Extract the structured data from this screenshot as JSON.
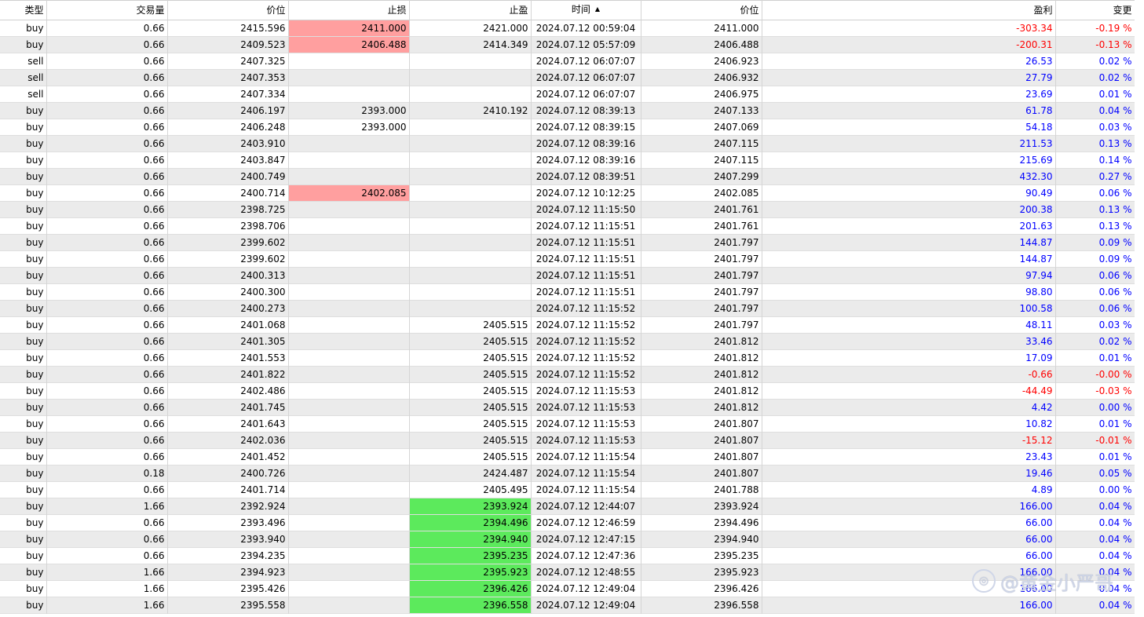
{
  "columns": {
    "type": "类型",
    "volume": "交易量",
    "open_price": "价位",
    "stop_loss": "止损",
    "take_profit": "止盈",
    "time": "时间",
    "price": "价位",
    "profit": "盈利",
    "change": "变更"
  },
  "sort": {
    "column": "time",
    "direction": "ascending",
    "icon": "sort-ascending-icon"
  },
  "colors": {
    "positive": "#0000ff",
    "negative": "#ff0000",
    "stop_loss_hit": "#ff9f9f",
    "take_profit_hit": "#5cea5c",
    "row_alt": "#ebebeb"
  },
  "rows": [
    {
      "type": "buy",
      "volume": "0.66",
      "open_price": "2415.596",
      "stop_loss": "2411.000",
      "take_profit": "2421.000",
      "time": "2024.07.12 00:59:04",
      "price": "2411.000",
      "profit": "-303.34",
      "change": "-0.19 %",
      "sl_hl": true,
      "tp_hl": false
    },
    {
      "type": "buy",
      "volume": "0.66",
      "open_price": "2409.523",
      "stop_loss": "2406.488",
      "take_profit": "2414.349",
      "time": "2024.07.12 05:57:09",
      "price": "2406.488",
      "profit": "-200.31",
      "change": "-0.13 %",
      "sl_hl": true,
      "tp_hl": false
    },
    {
      "type": "sell",
      "volume": "0.66",
      "open_price": "2407.325",
      "stop_loss": "",
      "take_profit": "",
      "time": "2024.07.12 06:07:07",
      "price": "2406.923",
      "profit": "26.53",
      "change": "0.02 %",
      "sl_hl": false,
      "tp_hl": false
    },
    {
      "type": "sell",
      "volume": "0.66",
      "open_price": "2407.353",
      "stop_loss": "",
      "take_profit": "",
      "time": "2024.07.12 06:07:07",
      "price": "2406.932",
      "profit": "27.79",
      "change": "0.02 %",
      "sl_hl": false,
      "tp_hl": false
    },
    {
      "type": "sell",
      "volume": "0.66",
      "open_price": "2407.334",
      "stop_loss": "",
      "take_profit": "",
      "time": "2024.07.12 06:07:07",
      "price": "2406.975",
      "profit": "23.69",
      "change": "0.01 %",
      "sl_hl": false,
      "tp_hl": false
    },
    {
      "type": "buy",
      "volume": "0.66",
      "open_price": "2406.197",
      "stop_loss": "2393.000",
      "take_profit": "2410.192",
      "time": "2024.07.12 08:39:13",
      "price": "2407.133",
      "profit": "61.78",
      "change": "0.04 %",
      "sl_hl": false,
      "tp_hl": false
    },
    {
      "type": "buy",
      "volume": "0.66",
      "open_price": "2406.248",
      "stop_loss": "2393.000",
      "take_profit": "",
      "time": "2024.07.12 08:39:15",
      "price": "2407.069",
      "profit": "54.18",
      "change": "0.03 %",
      "sl_hl": false,
      "tp_hl": false
    },
    {
      "type": "buy",
      "volume": "0.66",
      "open_price": "2403.910",
      "stop_loss": "",
      "take_profit": "",
      "time": "2024.07.12 08:39:16",
      "price": "2407.115",
      "profit": "211.53",
      "change": "0.13 %",
      "sl_hl": false,
      "tp_hl": false
    },
    {
      "type": "buy",
      "volume": "0.66",
      "open_price": "2403.847",
      "stop_loss": "",
      "take_profit": "",
      "time": "2024.07.12 08:39:16",
      "price": "2407.115",
      "profit": "215.69",
      "change": "0.14 %",
      "sl_hl": false,
      "tp_hl": false
    },
    {
      "type": "buy",
      "volume": "0.66",
      "open_price": "2400.749",
      "stop_loss": "",
      "take_profit": "",
      "time": "2024.07.12 08:39:51",
      "price": "2407.299",
      "profit": "432.30",
      "change": "0.27 %",
      "sl_hl": false,
      "tp_hl": false
    },
    {
      "type": "buy",
      "volume": "0.66",
      "open_price": "2400.714",
      "stop_loss": "2402.085",
      "take_profit": "",
      "time": "2024.07.12 10:12:25",
      "price": "2402.085",
      "profit": "90.49",
      "change": "0.06 %",
      "sl_hl": true,
      "tp_hl": false
    },
    {
      "type": "buy",
      "volume": "0.66",
      "open_price": "2398.725",
      "stop_loss": "",
      "take_profit": "",
      "time": "2024.07.12 11:15:50",
      "price": "2401.761",
      "profit": "200.38",
      "change": "0.13 %",
      "sl_hl": false,
      "tp_hl": false
    },
    {
      "type": "buy",
      "volume": "0.66",
      "open_price": "2398.706",
      "stop_loss": "",
      "take_profit": "",
      "time": "2024.07.12 11:15:51",
      "price": "2401.761",
      "profit": "201.63",
      "change": "0.13 %",
      "sl_hl": false,
      "tp_hl": false
    },
    {
      "type": "buy",
      "volume": "0.66",
      "open_price": "2399.602",
      "stop_loss": "",
      "take_profit": "",
      "time": "2024.07.12 11:15:51",
      "price": "2401.797",
      "profit": "144.87",
      "change": "0.09 %",
      "sl_hl": false,
      "tp_hl": false
    },
    {
      "type": "buy",
      "volume": "0.66",
      "open_price": "2399.602",
      "stop_loss": "",
      "take_profit": "",
      "time": "2024.07.12 11:15:51",
      "price": "2401.797",
      "profit": "144.87",
      "change": "0.09 %",
      "sl_hl": false,
      "tp_hl": false
    },
    {
      "type": "buy",
      "volume": "0.66",
      "open_price": "2400.313",
      "stop_loss": "",
      "take_profit": "",
      "time": "2024.07.12 11:15:51",
      "price": "2401.797",
      "profit": "97.94",
      "change": "0.06 %",
      "sl_hl": false,
      "tp_hl": false
    },
    {
      "type": "buy",
      "volume": "0.66",
      "open_price": "2400.300",
      "stop_loss": "",
      "take_profit": "",
      "time": "2024.07.12 11:15:51",
      "price": "2401.797",
      "profit": "98.80",
      "change": "0.06 %",
      "sl_hl": false,
      "tp_hl": false
    },
    {
      "type": "buy",
      "volume": "0.66",
      "open_price": "2400.273",
      "stop_loss": "",
      "take_profit": "",
      "time": "2024.07.12 11:15:52",
      "price": "2401.797",
      "profit": "100.58",
      "change": "0.06 %",
      "sl_hl": false,
      "tp_hl": false
    },
    {
      "type": "buy",
      "volume": "0.66",
      "open_price": "2401.068",
      "stop_loss": "",
      "take_profit": "2405.515",
      "time": "2024.07.12 11:15:52",
      "price": "2401.797",
      "profit": "48.11",
      "change": "0.03 %",
      "sl_hl": false,
      "tp_hl": false
    },
    {
      "type": "buy",
      "volume": "0.66",
      "open_price": "2401.305",
      "stop_loss": "",
      "take_profit": "2405.515",
      "time": "2024.07.12 11:15:52",
      "price": "2401.812",
      "profit": "33.46",
      "change": "0.02 %",
      "sl_hl": false,
      "tp_hl": false
    },
    {
      "type": "buy",
      "volume": "0.66",
      "open_price": "2401.553",
      "stop_loss": "",
      "take_profit": "2405.515",
      "time": "2024.07.12 11:15:52",
      "price": "2401.812",
      "profit": "17.09",
      "change": "0.01 %",
      "sl_hl": false,
      "tp_hl": false
    },
    {
      "type": "buy",
      "volume": "0.66",
      "open_price": "2401.822",
      "stop_loss": "",
      "take_profit": "2405.515",
      "time": "2024.07.12 11:15:52",
      "price": "2401.812",
      "profit": "-0.66",
      "change": "-0.00 %",
      "sl_hl": false,
      "tp_hl": false
    },
    {
      "type": "buy",
      "volume": "0.66",
      "open_price": "2402.486",
      "stop_loss": "",
      "take_profit": "2405.515",
      "time": "2024.07.12 11:15:53",
      "price": "2401.812",
      "profit": "-44.49",
      "change": "-0.03 %",
      "sl_hl": false,
      "tp_hl": false
    },
    {
      "type": "buy",
      "volume": "0.66",
      "open_price": "2401.745",
      "stop_loss": "",
      "take_profit": "2405.515",
      "time": "2024.07.12 11:15:53",
      "price": "2401.812",
      "profit": "4.42",
      "change": "0.00 %",
      "sl_hl": false,
      "tp_hl": false
    },
    {
      "type": "buy",
      "volume": "0.66",
      "open_price": "2401.643",
      "stop_loss": "",
      "take_profit": "2405.515",
      "time": "2024.07.12 11:15:53",
      "price": "2401.807",
      "profit": "10.82",
      "change": "0.01 %",
      "sl_hl": false,
      "tp_hl": false
    },
    {
      "type": "buy",
      "volume": "0.66",
      "open_price": "2402.036",
      "stop_loss": "",
      "take_profit": "2405.515",
      "time": "2024.07.12 11:15:53",
      "price": "2401.807",
      "profit": "-15.12",
      "change": "-0.01 %",
      "sl_hl": false,
      "tp_hl": false
    },
    {
      "type": "buy",
      "volume": "0.66",
      "open_price": "2401.452",
      "stop_loss": "",
      "take_profit": "2405.515",
      "time": "2024.07.12 11:15:54",
      "price": "2401.807",
      "profit": "23.43",
      "change": "0.01 %",
      "sl_hl": false,
      "tp_hl": false
    },
    {
      "type": "buy",
      "volume": "0.18",
      "open_price": "2400.726",
      "stop_loss": "",
      "take_profit": "2424.487",
      "time": "2024.07.12 11:15:54",
      "price": "2401.807",
      "profit": "19.46",
      "change": "0.05 %",
      "sl_hl": false,
      "tp_hl": false
    },
    {
      "type": "buy",
      "volume": "0.66",
      "open_price": "2401.714",
      "stop_loss": "",
      "take_profit": "2405.495",
      "time": "2024.07.12 11:15:54",
      "price": "2401.788",
      "profit": "4.89",
      "change": "0.00 %",
      "sl_hl": false,
      "tp_hl": false
    },
    {
      "type": "buy",
      "volume": "1.66",
      "open_price": "2392.924",
      "stop_loss": "",
      "take_profit": "2393.924",
      "time": "2024.07.12 12:44:07",
      "price": "2393.924",
      "profit": "166.00",
      "change": "0.04 %",
      "sl_hl": false,
      "tp_hl": true
    },
    {
      "type": "buy",
      "volume": "0.66",
      "open_price": "2393.496",
      "stop_loss": "",
      "take_profit": "2394.496",
      "time": "2024.07.12 12:46:59",
      "price": "2394.496",
      "profit": "66.00",
      "change": "0.04 %",
      "sl_hl": false,
      "tp_hl": true
    },
    {
      "type": "buy",
      "volume": "0.66",
      "open_price": "2393.940",
      "stop_loss": "",
      "take_profit": "2394.940",
      "time": "2024.07.12 12:47:15",
      "price": "2394.940",
      "profit": "66.00",
      "change": "0.04 %",
      "sl_hl": false,
      "tp_hl": true
    },
    {
      "type": "buy",
      "volume": "0.66",
      "open_price": "2394.235",
      "stop_loss": "",
      "take_profit": "2395.235",
      "time": "2024.07.12 12:47:36",
      "price": "2395.235",
      "profit": "66.00",
      "change": "0.04 %",
      "sl_hl": false,
      "tp_hl": true
    },
    {
      "type": "buy",
      "volume": "1.66",
      "open_price": "2394.923",
      "stop_loss": "",
      "take_profit": "2395.923",
      "time": "2024.07.12 12:48:55",
      "price": "2395.923",
      "profit": "166.00",
      "change": "0.04 %",
      "sl_hl": false,
      "tp_hl": true
    },
    {
      "type": "buy",
      "volume": "1.66",
      "open_price": "2395.426",
      "stop_loss": "",
      "take_profit": "2396.426",
      "time": "2024.07.12 12:49:04",
      "price": "2396.426",
      "profit": "166.00",
      "change": "0.04 %",
      "sl_hl": false,
      "tp_hl": true
    },
    {
      "type": "buy",
      "volume": "1.66",
      "open_price": "2395.558",
      "stop_loss": "",
      "take_profit": "2396.558",
      "time": "2024.07.12 12:49:04",
      "price": "2396.558",
      "profit": "166.00",
      "change": "0.04 %",
      "sl_hl": false,
      "tp_hl": true
    }
  ],
  "watermark": {
    "text": "@黄金小严哥",
    "icon": "watermark-logo-icon"
  }
}
